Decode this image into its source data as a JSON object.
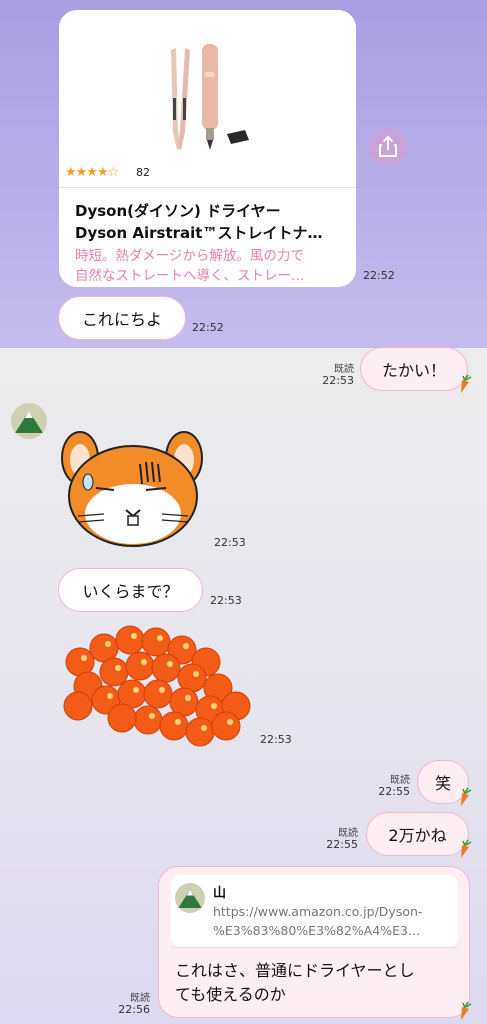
{
  "product_card": {
    "rating_stars": "★★★★☆",
    "rating_value": 4.5,
    "rating_count": "82",
    "title_line1": "Dyson(ダイソン) ドライヤー",
    "title_line2": "Dyson Airstrait™ストレイトナ…",
    "desc_line1": "時短。熱ダメージから解放。風の力で",
    "desc_line2": "自然なストレートへ導く、ストレー…",
    "time": "22:52",
    "icon": "share-icon"
  },
  "messages": [
    {
      "side": "left",
      "text": "これにちよ",
      "time": "22:52"
    },
    {
      "side": "right",
      "text": "たかい！",
      "read": "既読",
      "time": "22:53"
    },
    {
      "side": "left",
      "type": "sticker",
      "sticker": "hamster-sweat-sticker",
      "time": "22:53"
    },
    {
      "side": "left",
      "text": "いくらまで？",
      "time": "22:53"
    },
    {
      "side": "left",
      "type": "sticker",
      "sticker": "salmon-roe-sticker",
      "time": "22:53"
    },
    {
      "side": "right",
      "text": "笑",
      "read": "既読",
      "time": "22:55"
    },
    {
      "side": "right",
      "text": "2万かね",
      "read": "既読",
      "time": "22:55"
    },
    {
      "side": "right",
      "type": "reply",
      "quote_author": "山",
      "quote_url_line1": "https://www.amazon.co.jp/Dyson-",
      "quote_url_line2": "%E3%83%80%E3%82%A4%E3…",
      "text_line1": "これはさ、普通にドライヤーとし",
      "text_line2": "ても使えるのか",
      "read": "既読",
      "time": "22:56"
    }
  ],
  "colors": {
    "top_background": "#b3a9e6",
    "bubble_border": "#f0b6cf",
    "outgoing_bubble": "#fdeef4",
    "link_desc": "#e882b0",
    "share_button": "#c7a3d9"
  }
}
